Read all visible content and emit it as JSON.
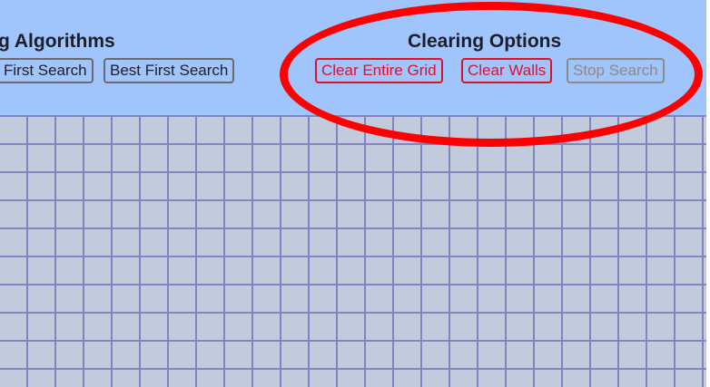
{
  "algorithms": {
    "title": "g Algorithms",
    "buttons": [
      "First Search",
      "Best First Search"
    ]
  },
  "clearing": {
    "title": "Clearing Options",
    "clear_grid": "Clear Entire Grid",
    "clear_walls": "Clear Walls",
    "stop_search": "Stop Search"
  },
  "colors": {
    "header": "#a0c4fc",
    "cell": "#c2cbdb",
    "grid_line": "#8383c4",
    "danger": "#e0102a",
    "annotation": "#ff0000"
  }
}
